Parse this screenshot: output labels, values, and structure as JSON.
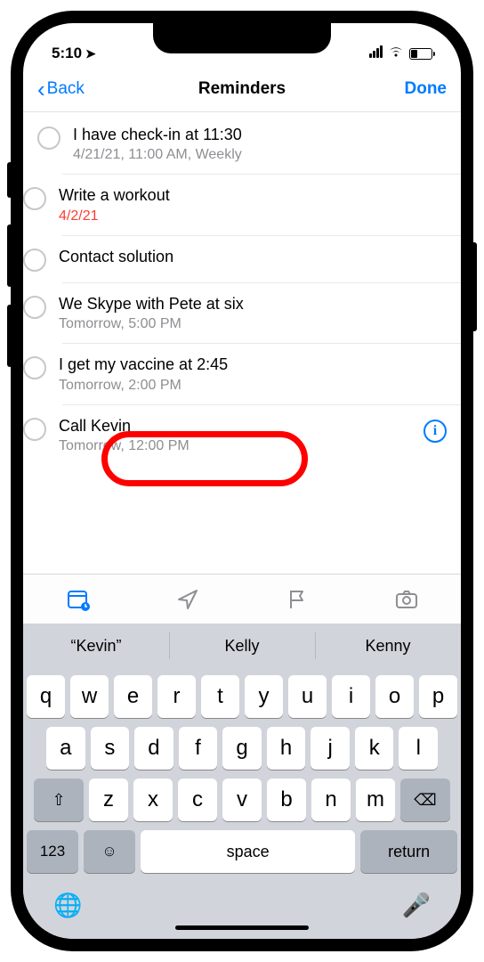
{
  "status": {
    "time": "5:10",
    "loc_icon": "➤"
  },
  "nav": {
    "back": "Back",
    "title": "Reminders",
    "done": "Done"
  },
  "reminders": [
    {
      "title": "I have check-in at 11:30",
      "sub": "4/21/21, 11:00 AM, Weekly",
      "overdue": false,
      "info": false
    },
    {
      "title": "Write a workout",
      "sub": "4/2/21",
      "overdue": true,
      "info": false
    },
    {
      "title": "Contact solution",
      "sub": "",
      "overdue": false,
      "info": false
    },
    {
      "title": "We Skype with Pete at six",
      "sub": "Tomorrow, 5:00 PM",
      "overdue": false,
      "info": false
    },
    {
      "title": "I get my vaccine at 2:45",
      "sub": "Tomorrow, 2:00 PM",
      "overdue": false,
      "info": false
    },
    {
      "title": "Call Kevin",
      "sub": "Tomorrow, 12:00 PM",
      "overdue": false,
      "info": true
    }
  ],
  "info_glyph": "i",
  "suggestions": [
    "“Kevin”",
    "Kelly",
    "Kenny"
  ],
  "keys": {
    "row1": [
      "q",
      "w",
      "e",
      "r",
      "t",
      "y",
      "u",
      "i",
      "o",
      "p"
    ],
    "row2": [
      "a",
      "s",
      "d",
      "f",
      "g",
      "h",
      "j",
      "k",
      "l"
    ],
    "row3": [
      "z",
      "x",
      "c",
      "v",
      "b",
      "n",
      "m"
    ],
    "num": "123",
    "space": "space",
    "return": "return",
    "shift": "⇧",
    "bksp": "⌫",
    "emoji": "☺",
    "globe": "🌐",
    "mic": "🎤"
  }
}
